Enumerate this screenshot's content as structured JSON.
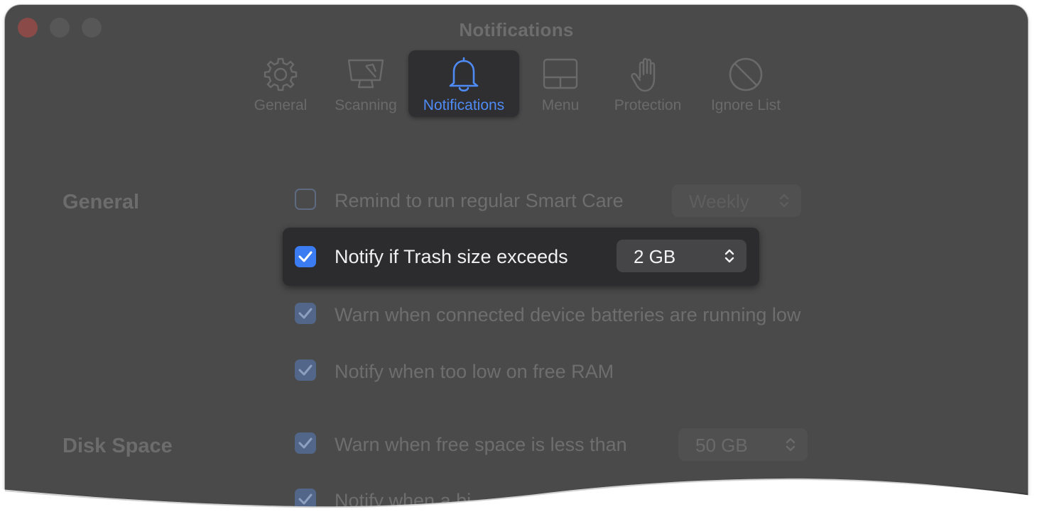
{
  "window": {
    "title": "Notifications"
  },
  "tabs": [
    {
      "label": "General",
      "icon": "gear-icon"
    },
    {
      "label": "Scanning",
      "icon": "scanning-monitor-icon"
    },
    {
      "label": "Notifications",
      "icon": "bell-icon"
    },
    {
      "label": "Menu",
      "icon": "menu-window-icon"
    },
    {
      "label": "Protection",
      "icon": "hand-icon"
    },
    {
      "label": "Ignore List",
      "icon": "prohibit-icon"
    }
  ],
  "active_tab": "Notifications",
  "sections": {
    "general": {
      "title": "General",
      "smart_care": {
        "label": "Remind to run regular Smart Care",
        "checked": false,
        "frequency": "Weekly"
      },
      "trash": {
        "label": "Notify if Trash size exceeds",
        "checked": true,
        "size": "2 GB"
      },
      "batteries": {
        "label": "Warn when connected device batteries are running low",
        "checked": true
      },
      "ram": {
        "label": "Notify when too low on free RAM",
        "checked": true
      }
    },
    "disk_space": {
      "title": "Disk Space",
      "free_space": {
        "label": "Warn when free space is less than",
        "checked": true,
        "size": "50 GB"
      },
      "partial": {
        "label": "Notify when a bi",
        "checked": true
      }
    }
  },
  "colors": {
    "window_bg": "#4a4a4a",
    "accent": "#3b7cf2",
    "active_tab_text": "#4f8bf5",
    "focus_card_bg": "#2c2c2e"
  }
}
